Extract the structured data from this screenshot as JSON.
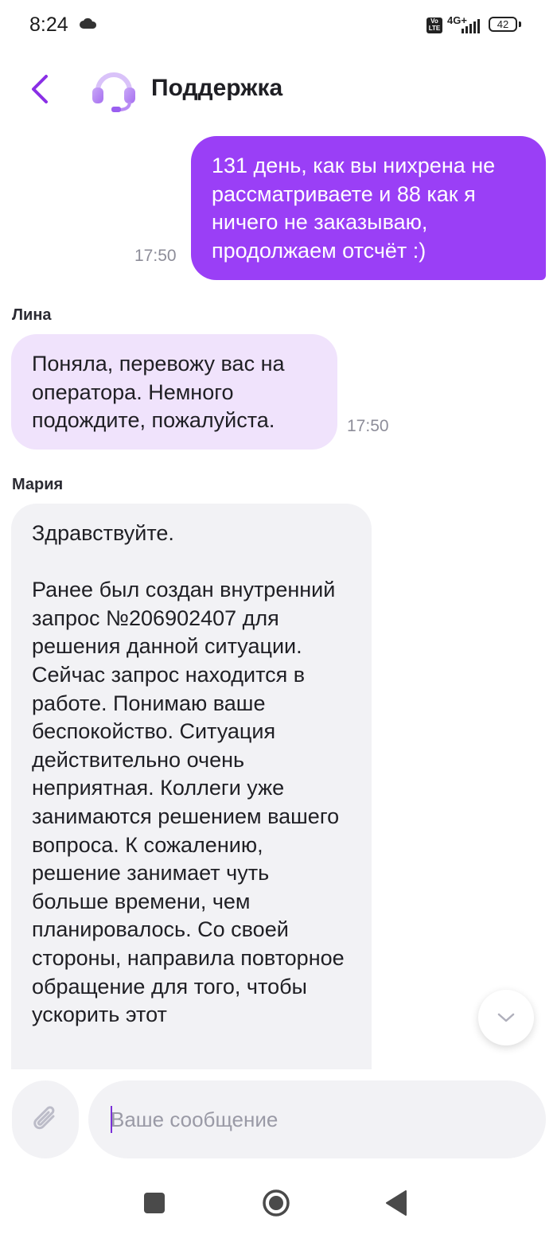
{
  "status_bar": {
    "time": "8:24",
    "volte": "Vo LTE",
    "network": "4G+",
    "battery": "42"
  },
  "header": {
    "title": "Поддержка",
    "accent_color": "#9a3ff6"
  },
  "messages": [
    {
      "direction": "outgoing",
      "text": "131 день, как вы нихрена не рассматриваете и 88 как я ничего не заказываю, продолжаем отсчёт :)",
      "time": "17:50"
    },
    {
      "direction": "incoming",
      "sender": "Лина",
      "text": "Поняла, перевожу вас на оператора. Немного подождите, пожалуйста.",
      "time": "17:50"
    },
    {
      "direction": "incoming",
      "sender": "Мария",
      "text": "Здравствуйте.\n\nРанее был создан внутренний запрос №206902407 для решения данной ситуации. Сейчас запрос находится в работе. Понимаю ваше беспокойство. Ситуация действительно очень неприятная. Коллеги уже занимаются решением вашего вопроса. К сожалению, решение занимает чуть больше времени, чем планировалось. Со своей стороны, направила повторное обращение для того, чтобы ускорить этот"
    }
  ],
  "composer": {
    "placeholder": "Ваше сообщение",
    "value": ""
  },
  "icons": {
    "back": "chevron-left-icon",
    "avatar": "headset-icon",
    "attach": "paperclip-icon",
    "scroll": "chevron-down-icon"
  }
}
